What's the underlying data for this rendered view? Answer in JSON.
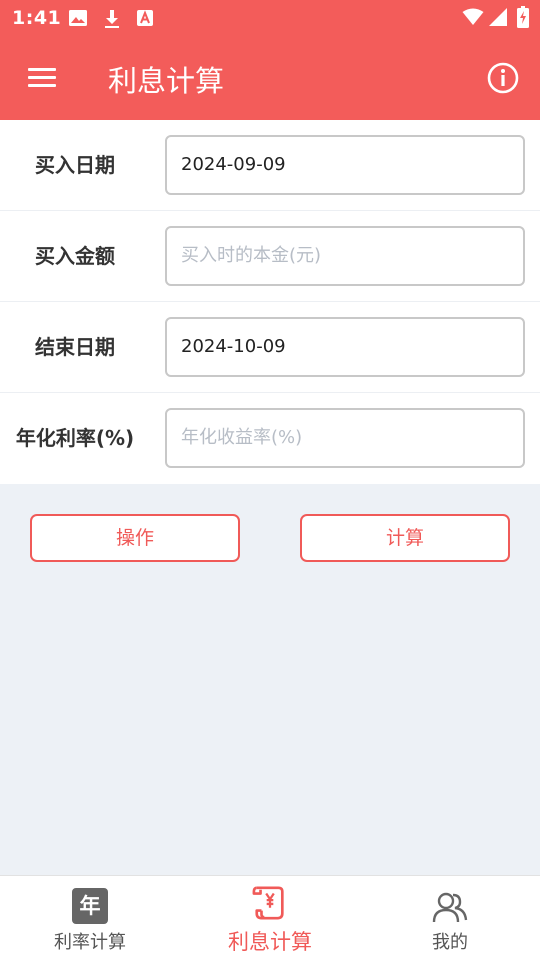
{
  "status_bar": {
    "time": "1:41",
    "icons": [
      "image-icon",
      "download-icon",
      "font-icon",
      "wifi-icon",
      "signal-icon",
      "battery-charging-icon"
    ]
  },
  "app_bar": {
    "title": "利息计算",
    "menu_icon": "menu-icon",
    "info_icon": "info-icon"
  },
  "form": {
    "buy_date": {
      "label": "买入日期",
      "value": "2024-09-09"
    },
    "buy_amount": {
      "label": "买入金额",
      "value": "",
      "placeholder": "买入时的本金(元)"
    },
    "end_date": {
      "label": "结束日期",
      "value": "2024-10-09"
    },
    "annual_rate": {
      "label": "年化利率(%)",
      "value": "",
      "placeholder": "年化收益率(%)"
    }
  },
  "actions": {
    "operate_label": "操作",
    "calculate_label": "计算"
  },
  "bottom_nav": {
    "items": [
      {
        "label": "利率计算",
        "icon": "calendar-year-icon",
        "icon_text": "年",
        "active": false
      },
      {
        "label": "利息计算",
        "icon": "scroll-yen-icon",
        "active": true
      },
      {
        "label": "我的",
        "icon": "users-icon",
        "active": false
      }
    ]
  },
  "colors": {
    "primary": "#f35c5a",
    "accent": "#f05a58",
    "background": "#edf1f6"
  }
}
